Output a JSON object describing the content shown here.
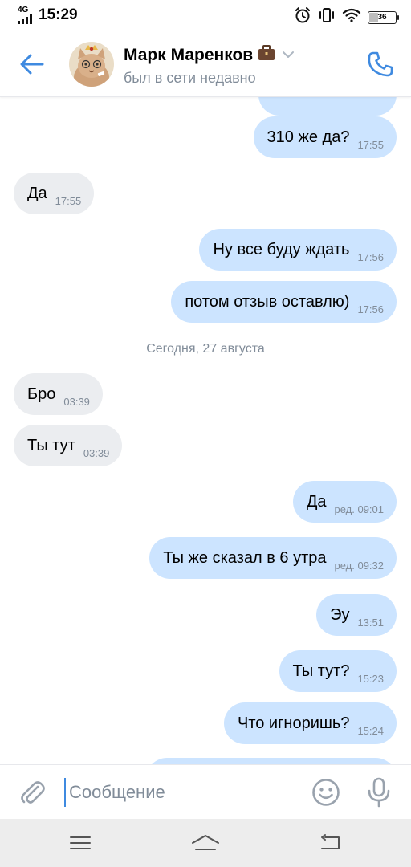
{
  "status_bar": {
    "network": "4G",
    "time": "15:29",
    "battery": "36",
    "battery_level": 0.36,
    "icons": [
      "alarm-icon",
      "vibrate-icon",
      "wifi-icon",
      "battery-icon"
    ]
  },
  "header": {
    "contact_name": "Марк Маренков",
    "contact_status": "был в сети недавно",
    "icons": [
      "back-arrow-icon",
      "briefcase-icon",
      "chevron-down-icon",
      "phone-icon"
    ]
  },
  "messages": [
    {
      "direction": "out",
      "text": "310 же да?",
      "time": "17:55"
    },
    {
      "direction": "in",
      "text": "Да",
      "time": "17:55"
    },
    {
      "direction": "out",
      "text": "Ну все буду ждать",
      "time": "17:56"
    },
    {
      "direction": "out",
      "text": "потом отзыв оставлю)",
      "time": "17:56"
    },
    {
      "direction": "in",
      "text": "Бро",
      "time": "03:39"
    },
    {
      "direction": "in",
      "text": "Ты тут",
      "time": "03:39"
    },
    {
      "direction": "out",
      "text": "Да",
      "time": "ред. 09:01"
    },
    {
      "direction": "out",
      "text": "Ты же сказал в 6 утра",
      "time": "ред. 09:32"
    },
    {
      "direction": "out",
      "text": "Эу",
      "time": "13:51"
    },
    {
      "direction": "out",
      "text": "Ты тут?",
      "time": "15:23"
    },
    {
      "direction": "out",
      "text": "Что игноришь?",
      "time": "15:24"
    }
  ],
  "date_separator": "Сегодня, 27 августа",
  "input": {
    "placeholder": "Сообщение",
    "value": "",
    "icons": [
      "paperclip-icon",
      "emoji-icon",
      "microphone-icon"
    ]
  },
  "nav_bar": {
    "icons": [
      "menu-icon",
      "home-icon",
      "back-icon"
    ]
  },
  "colors": {
    "accent": "#3f8ae0",
    "outgoing_bubble": "#cce4ff",
    "incoming_bubble": "#ebedf0",
    "secondary_text": "#818c99",
    "nav_bar_bg": "#ededed"
  }
}
